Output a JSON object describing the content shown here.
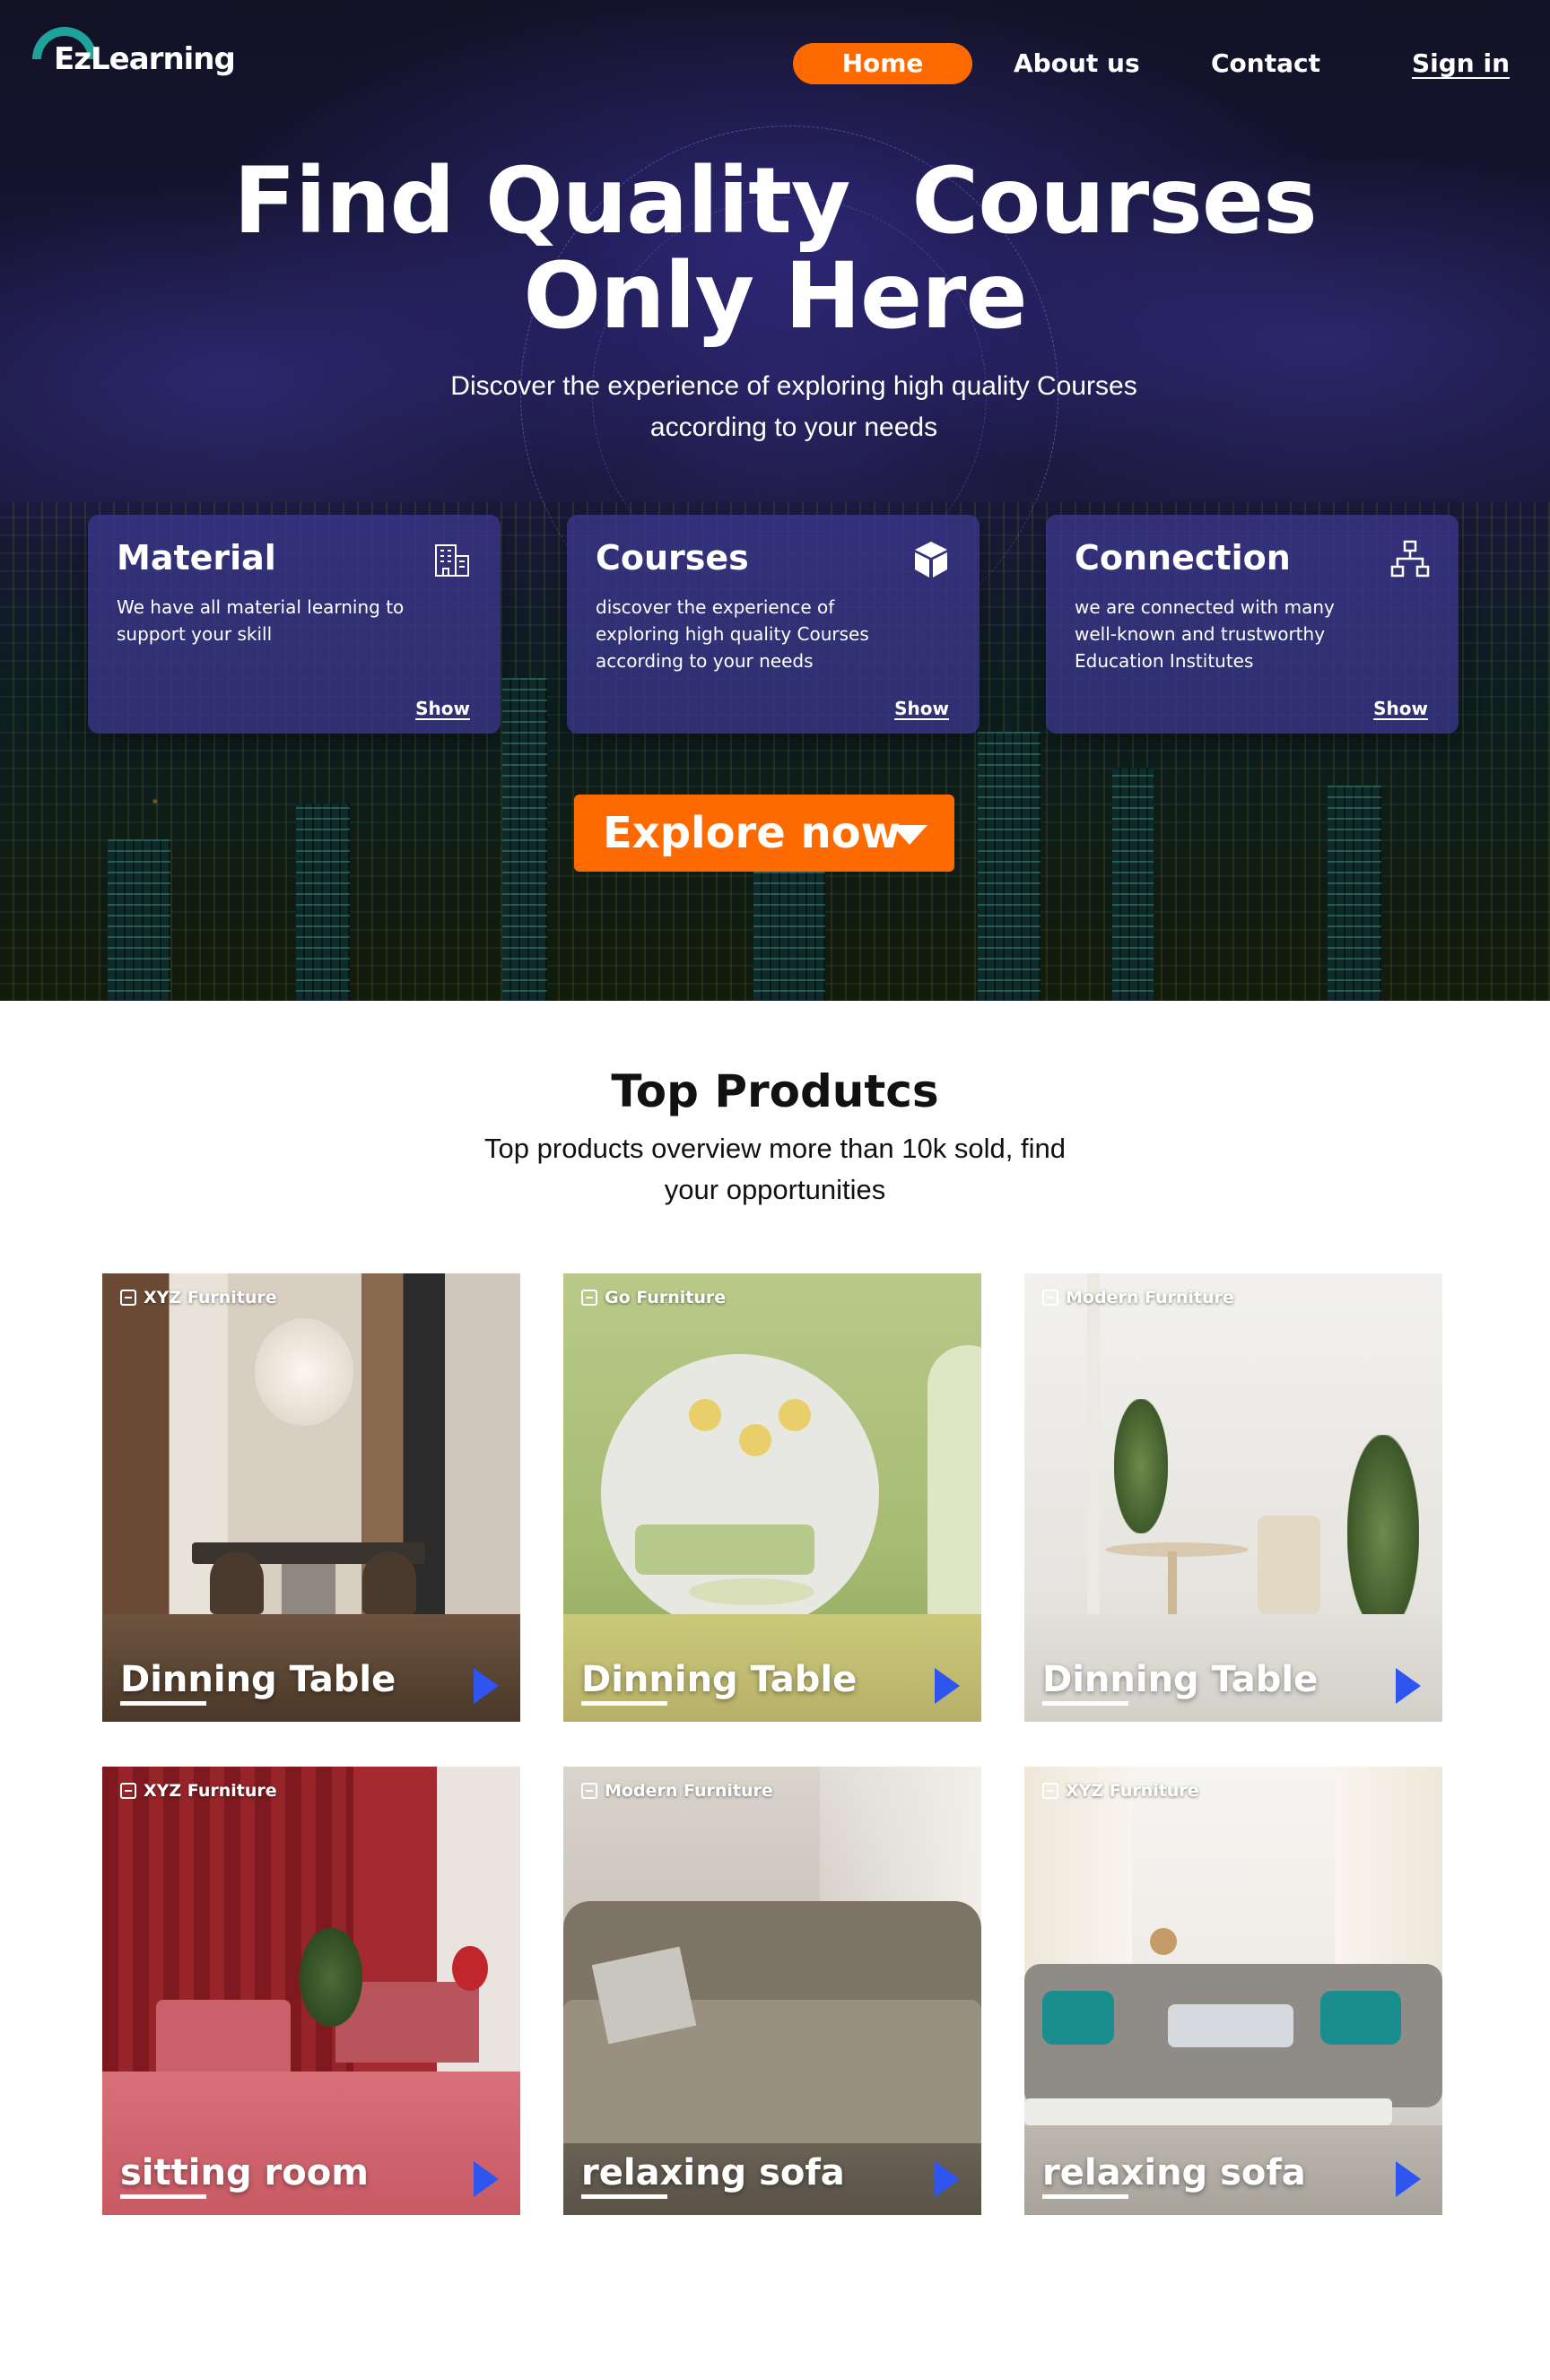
{
  "brand": {
    "logo_text": "EzLearning",
    "accent": "#ff6a00",
    "logo_color": "#1ea39a"
  },
  "nav": {
    "home": "Home",
    "about": "About us",
    "contact": "Contact",
    "signin": "Sign in"
  },
  "hero": {
    "title_line1": "Find Quality  Courses",
    "title_line2": "Only Here",
    "subtitle_line1": "Discover the experience of exploring high quality Courses",
    "subtitle_line2": "according to your needs",
    "features": [
      {
        "title": "Material",
        "desc": "We have all material learning to support your skill",
        "show": "Show",
        "icon": "building-icon"
      },
      {
        "title": "Courses",
        "desc": "discover the experience of exploring high quality Courses according to your needs",
        "show": "Show",
        "icon": "cube-icon"
      },
      {
        "title": "Connection",
        "desc": "we are connected with many well-known and trustworthy Education Institutes",
        "show": "Show",
        "icon": "network-icon"
      }
    ],
    "explore": "Explore now"
  },
  "products": {
    "title": "Top Produtcs",
    "subtitle_line1": "Top products overview more than 10k sold, find",
    "subtitle_line2": "your opportunities",
    "play_color": "#2f55f0",
    "items": [
      {
        "vendor": "XYZ Furniture",
        "title": "Dinning Table"
      },
      {
        "vendor": "Go Furniture",
        "title": "Dinning Table"
      },
      {
        "vendor": "Modern Furniture",
        "title": "Dinning Table"
      },
      {
        "vendor": "XYZ Furniture",
        "title": "sitting room"
      },
      {
        "vendor": "Modern Furniture",
        "title": "relaxing sofa"
      },
      {
        "vendor": "XYZ Furniture",
        "title": "relaxing sofa"
      }
    ]
  }
}
